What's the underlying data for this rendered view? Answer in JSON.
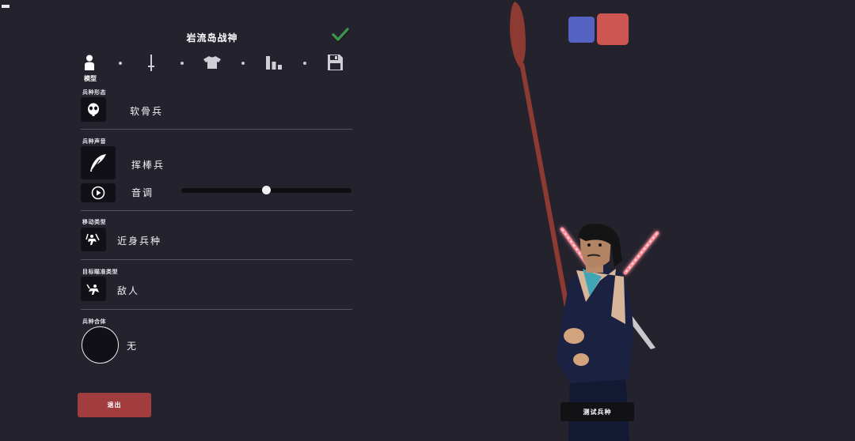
{
  "header": {
    "unit_name": "岩流岛战神"
  },
  "tabs": [
    {
      "id": "model",
      "icon": "person-icon",
      "label": "模型",
      "active": true
    },
    {
      "id": "weapons",
      "icon": "sword-icon"
    },
    {
      "id": "clothing",
      "icon": "shirt-icon"
    },
    {
      "id": "stats",
      "icon": "bar-chart-icon"
    },
    {
      "id": "save",
      "icon": "save-icon"
    }
  ],
  "sections": {
    "unit_form": {
      "label": "兵种形态",
      "value": "软骨兵",
      "icon": "skull-icon"
    },
    "unit_voice": {
      "label": "兵种声音",
      "value": "挥棒兵",
      "icon": "feather-icon",
      "pitch_label": "音调",
      "pitch_value": 0.5,
      "play_icon": "play-icon"
    },
    "movement": {
      "label": "移动类型",
      "value": "近身兵种",
      "icon": "melee-icon"
    },
    "targeting": {
      "label": "目标瞄准类型",
      "value": "敌人",
      "icon": "target-enemy-icon"
    },
    "mount": {
      "label": "兵种合体",
      "value": "无"
    }
  },
  "buttons": {
    "exit": "退出",
    "test_unit": "测试兵种"
  },
  "colors": {
    "background": "#24222d",
    "team_blue": "#5563c2",
    "team_red": "#cd5552",
    "exit_button": "#a23d3f",
    "confirm_check": "#3f8f4f"
  }
}
